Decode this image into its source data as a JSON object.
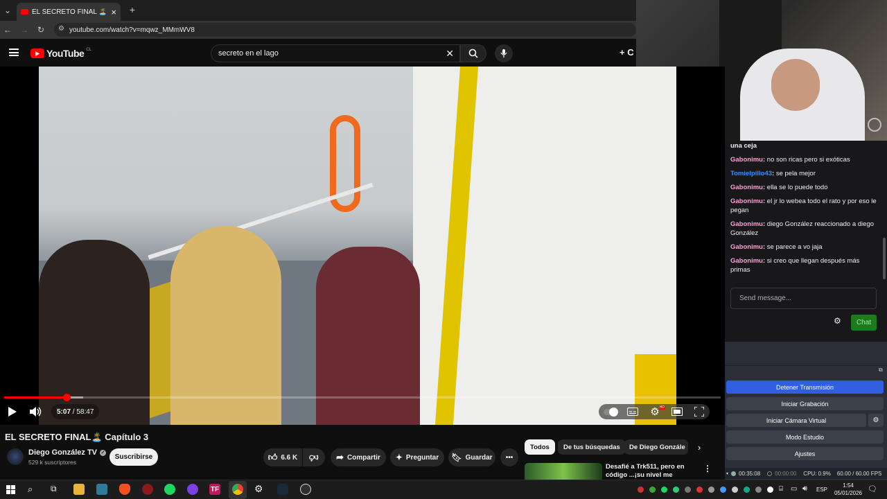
{
  "browser": {
    "tab_title": "EL SECRETO FINAL 🏝️ Capítulo",
    "tab_close": "×",
    "new_tab": "+",
    "url": "youtube.com/watch?v=mqwz_MMmWV8"
  },
  "youtube": {
    "logo_text": "YouTube",
    "country_code": "CL",
    "search_value": "secreto en el lago",
    "create_label": "+ C"
  },
  "player": {
    "time_current": "5:07",
    "time_separator": " / ",
    "time_total": "58:47",
    "progress_fraction": 0.087,
    "buffer_fraction": 0.11,
    "settings_badge": "HD"
  },
  "video_info": {
    "title": "EL SECRETO FINAL🏝️ Capítulo 3",
    "channel_name": "Diego González TV",
    "subscribers": "529 k suscriptores",
    "subscribe_label": "Suscribirse",
    "likes": "6.6 K",
    "share_label": "Compartir",
    "ask_label": "Preguntar",
    "save_label": "Guardar"
  },
  "filters": {
    "chips": [
      "Todos",
      "De tus búsquedas",
      "De Diego Gonzále"
    ]
  },
  "recommended": {
    "title_line1": "Desafié a Trk511, pero en",
    "title_line2": "código ...¡su nivel me"
  },
  "chat": {
    "top_text": "una ceja",
    "messages": [
      {
        "user": "Gabonimu",
        "text": "no son ricas pero si exóticas",
        "color": "#ff9fd6"
      },
      {
        "user": "Tomielpillo43",
        "text": "se pela mejor",
        "color": "#3d8bff"
      },
      {
        "user": "Gabonimu",
        "text": "ella se lo puede todo",
        "color": "#ff9fd6"
      },
      {
        "user": "Gabonimu",
        "text": "el jr lo webea todo el rato y por eso le pegan",
        "color": "#ff9fd6"
      },
      {
        "user": "Gabonimu",
        "text": "diego González reaccionado a diego González",
        "color": "#ff9fd6"
      },
      {
        "user": "Gabonimu",
        "text": "se parece a vo jaja",
        "color": "#ff9fd6"
      },
      {
        "user": "Gabonimu",
        "text": "si creo que llegan después más primas",
        "color": "#ff9fd6"
      }
    ],
    "input_placeholder": "Send message...",
    "send_label": "Chat"
  },
  "obs": {
    "stop_stream": "Detener Transmisión",
    "start_recording": "Iniciar Grabación",
    "virtual_cam": "Iniciar Cámara Virtual",
    "studio_mode": "Modo Estudio",
    "settings": "Ajustes",
    "stream_time": "00:35:08",
    "rec_time": "00:00:00",
    "cpu": "CPU: 0.9%",
    "fps": "60.00 / 60.00 FPS"
  },
  "taskbar": {
    "language": "ESP",
    "time": "1:54",
    "date": "05/01/2026"
  },
  "colors": {
    "yt_red": "#ff0000",
    "obs_blue": "#2f5fe0",
    "twitch_green": "#1f7a1f"
  }
}
